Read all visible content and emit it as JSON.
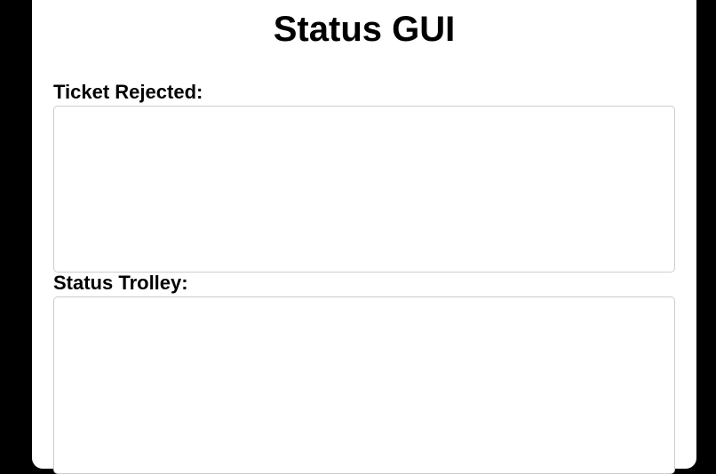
{
  "page": {
    "title": "Status GUI"
  },
  "fields": {
    "ticket_rejected": {
      "label": "Ticket Rejected:",
      "value": ""
    },
    "status_trolley": {
      "label": "Status Trolley:",
      "value": ""
    }
  },
  "colors": {
    "background": "#000000",
    "panel": "#ffffff",
    "field_border": "#cccccc",
    "text": "#000000"
  }
}
